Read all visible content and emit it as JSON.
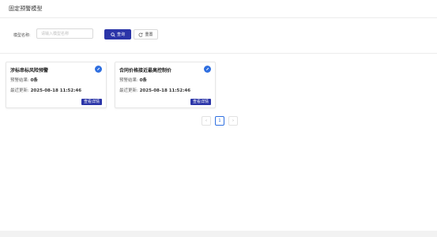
{
  "header": {
    "title": "固定预警模型"
  },
  "search": {
    "label": "模型名称:",
    "placeholder": "请输入模型名称",
    "query_label": "查询",
    "reset_label": "重置"
  },
  "cards": [
    {
      "title": "涉标串标风险预警",
      "result_label": "预警结果:",
      "result_value": "0条",
      "updated_label": "最近更新:",
      "updated_value": "2025-08-18 11:52:46",
      "detail_label": "查看详情"
    },
    {
      "title": "合同价格接近最高控制价",
      "result_label": "预警结果:",
      "result_value": "0条",
      "updated_label": "最近更新:",
      "updated_value": "2025-08-18 11:52:46",
      "detail_label": "查看详情"
    }
  ],
  "pagination": {
    "prev": "‹",
    "current": "1",
    "next": "›"
  },
  "icons": {
    "search": "search-icon",
    "reset": "refresh-icon",
    "edit": "edit-pencil-icon"
  },
  "colors": {
    "primary": "#2b35a8",
    "edit_icon": "#2f6fe0"
  }
}
